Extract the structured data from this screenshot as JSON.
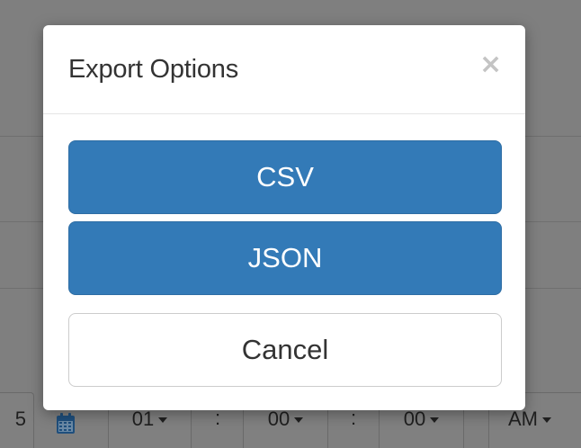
{
  "modal": {
    "title": "Export Options",
    "close_glyph": "×",
    "buttons": {
      "csv": "CSV",
      "json": "JSON",
      "cancel": "Cancel"
    }
  },
  "background": {
    "partial_value": "5",
    "calendar_icon": "calendar-icon",
    "hour": "01",
    "separator": ":",
    "minute": "00",
    "second": "00",
    "meridiem": "AM"
  },
  "colors": {
    "primary": "#337ab7",
    "primary_border": "#2e6da4",
    "overlay": "#7f7f7f",
    "title": "#333333",
    "close": "#c4c4c4"
  }
}
